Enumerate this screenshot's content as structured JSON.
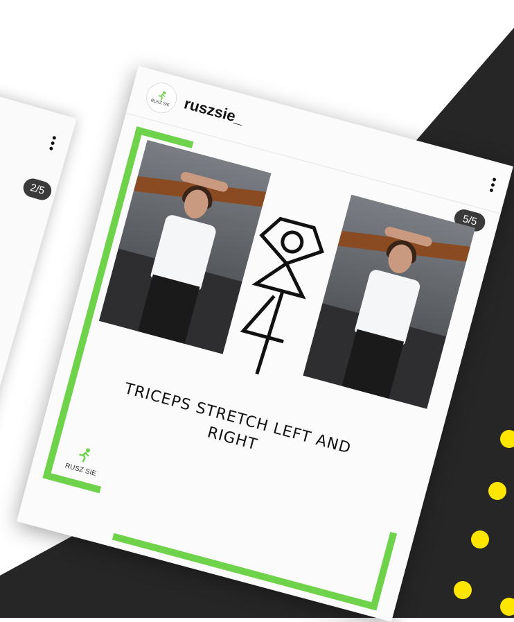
{
  "colors": {
    "background_dark": "#262626",
    "accent_green": "#6fd24b",
    "dot_yellow": "#ffe600",
    "badge_bg": "#3a3a3a"
  },
  "back_post": {
    "counter": "2/5",
    "menu_icon": "more-vertical-icon"
  },
  "post": {
    "username": "ruszsie_",
    "avatar_text": "RUSZ SIE",
    "counter": "5/5",
    "menu_icon": "more-vertical-icon",
    "caption": "TRICEPS STRETCH LEFT AND RIGHT",
    "corner_logo_text": "RUSZ SIE",
    "symbol_icon": "exercise-pictogram-icon"
  }
}
